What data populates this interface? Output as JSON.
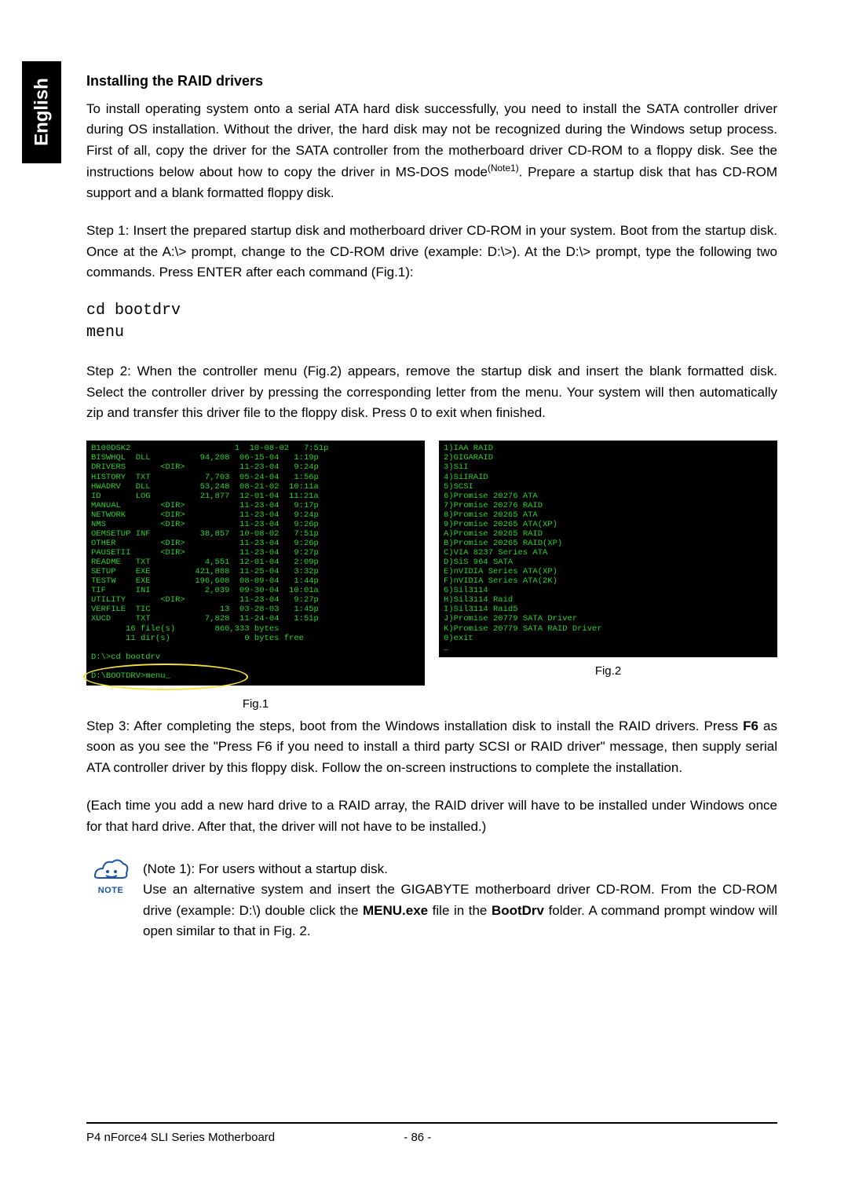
{
  "sidebar": {
    "label": "English"
  },
  "title": "Installing the RAID drivers",
  "intro": "To install operating system onto a serial ATA hard disk successfully, you need to install the SATA controller driver during OS installation. Without the driver, the hard disk may not be recognized during the Windows setup process.  First of all, copy the driver for the SATA controller from the motherboard driver CD-ROM to a floppy disk. See the instructions below about how to copy the driver in MS-DOS mode",
  "intro_note_ref": "(Note1)",
  "intro_tail": ". Prepare a startup disk that has CD-ROM support and a blank formatted floppy disk.",
  "step1": "Step 1: Insert the prepared startup disk and motherboard driver CD-ROM in your system.  Boot from the startup disk. Once at the A:\\> prompt, change to the CD-ROM drive (example: D:\\>).  At the D:\\> prompt, type the following two commands.  Press ENTER after each command (Fig.1):",
  "commands": [
    "cd bootdrv",
    "menu"
  ],
  "step2": "Step 2: When the controller menu (Fig.2) appears, remove the startup disk and insert the blank formatted disk.  Select the controller driver by pressing the corresponding letter from the menu.  Your system will then automatically zip and transfer this driver file to the floppy disk.  Press 0 to exit when finished.",
  "fig1": {
    "caption": "Fig.1",
    "lines": [
      "B100DSK2                     1  10-08-02   7:51p",
      "BISWHQL  DLL          94,208  06-15-04   1:19p",
      "DRIVERS       <DIR>           11-23-04   9:24p",
      "HISTORY  TXT           7,703  05-24-04   1:56p",
      "HWADRV   DLL          53,248  08-21-02  10:11a",
      "ID       LOG          21,877  12-01-04  11:21a",
      "MANUAL        <DIR>           11-23-04   9:17p",
      "NETWORK       <DIR>           11-23-04   9:24p",
      "NMS           <DIR>           11-23-04   9:26p",
      "OEMSETUP INF          38,857  10-08-02   7:51p",
      "OTHER         <DIR>           11-23-04   9:26p",
      "PAUSETII      <DIR>           11-23-04   9:27p",
      "README   TXT           4,551  12-01-04   2:09p",
      "SETUP    EXE         421,888  11-25-04   3:32p",
      "TESTW    EXE         196,608  08-09-04   1:44p",
      "TIF      INI           2,039  09-30-04  10:01a",
      "UTILITY       <DIR>           11-23-04   9:27p",
      "VERFILE  TIC              13  03-28-03   1:45p",
      "XUCD     TXT           7,828  11-24-04   1:51p",
      "       16 file(s)        860,333 bytes",
      "       11 dir(s)               0 bytes free",
      "",
      "D:\\>cd bootdrv",
      "",
      "D:\\BOOTDRV>menu_"
    ]
  },
  "fig2": {
    "caption": "Fig.2",
    "lines": [
      "1)IAA RAID",
      "2)GIGARAID",
      "3)SiI",
      "4)SiIRAID",
      "5)SCSI",
      "6)Promise 20276 ATA",
      "7)Promise 20276 RAID",
      "8)Promise 20265 ATA",
      "9)Promise 20265 ATA(XP)",
      "A)Promise 20265 RAID",
      "B)Promise 20265 RAID(XP)",
      "C)VIA 8237 Series ATA",
      "D)SiS 964 SATA",
      "E)nVIDIA Series ATA(XP)",
      "F)nVIDIA Series ATA(2K)",
      "G)Sil3114",
      "H)Sil3114 Raid",
      "I)Sil3114 Raid5",
      "J)Promise 20779 SATA Driver",
      "K)Promise 20779 SATA RAID Driver",
      "0)exit",
      "_"
    ]
  },
  "step3_a": "Step 3: After completing the steps, boot from the Windows installation disk to install the RAID drivers. Press ",
  "step3_f6": "F6",
  "step3_b": " as soon as you see the \"Press F6 if you need to install a third party SCSI or RAID driver\" message, then supply serial ATA controller driver by this floppy disk. Follow the on-screen instructions to complete the installation.",
  "each_time": "(Each time you add a new hard drive to a RAID array, the RAID driver will have to be installed under Windows once for that hard drive. After that, the driver will not have to be installed.)",
  "note": {
    "label": "NOTE",
    "line1": "(Note 1): For users without a startup disk.",
    "line2_a": "Use an alternative system and insert the GIGABYTE motherboard driver CD-ROM.  From the CD-ROM drive (example: D:\\) double click the ",
    "menu_exe": "MENU.exe",
    "line2_b": " file in the ",
    "bootdrv": "BootDrv",
    "line2_c": " folder. A command prompt window will open similar to that in Fig. 2."
  },
  "footer": {
    "product": "P4 nForce4 SLI Series Motherboard",
    "page": "- 86 -"
  }
}
